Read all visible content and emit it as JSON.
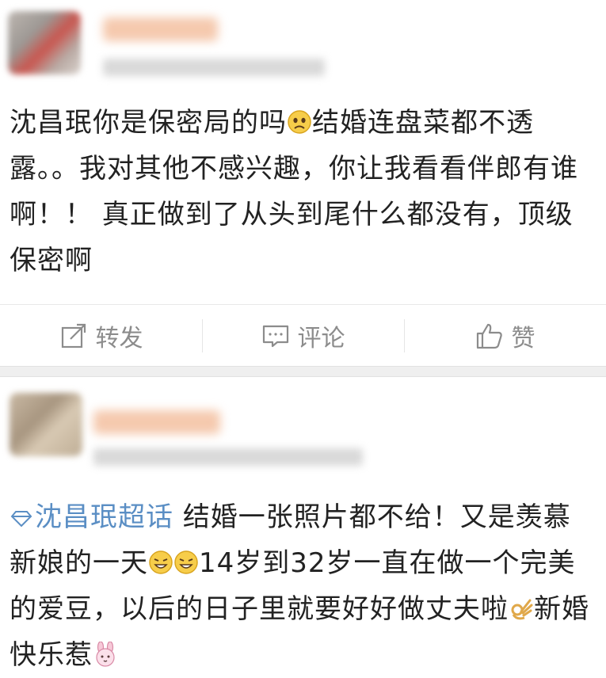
{
  "post1": {
    "text": "沈昌珉你是保密局的吗",
    "text_after_emoji": "结婚连盘菜都不透露。。我对其他不感兴趣，你让我看看伴郎有谁啊！！ 真正做到了从头到尾什么都没有，顶级保密啊",
    "emoji": "sad-face-icon"
  },
  "actions": {
    "repost": "转发",
    "comment": "评论",
    "like": "赞"
  },
  "post2": {
    "topic": "沈昌珉超话",
    "text_part1": "结婚一张照片都不给！又是羡慕新娘的一天",
    "text_part2": "14岁到32岁一直在做一个完美的爱豆，以后的日子里就要好好做丈夫啦",
    "text_part3": "新婚快乐惹",
    "emojis": [
      "grin-face-icon",
      "grin-face-icon",
      "ok-hand-icon",
      "bunny-face-icon"
    ]
  },
  "colors": {
    "topic_link": "#5a8ec4",
    "action_text": "#8c8c8c",
    "divider_band": "#efefef"
  }
}
